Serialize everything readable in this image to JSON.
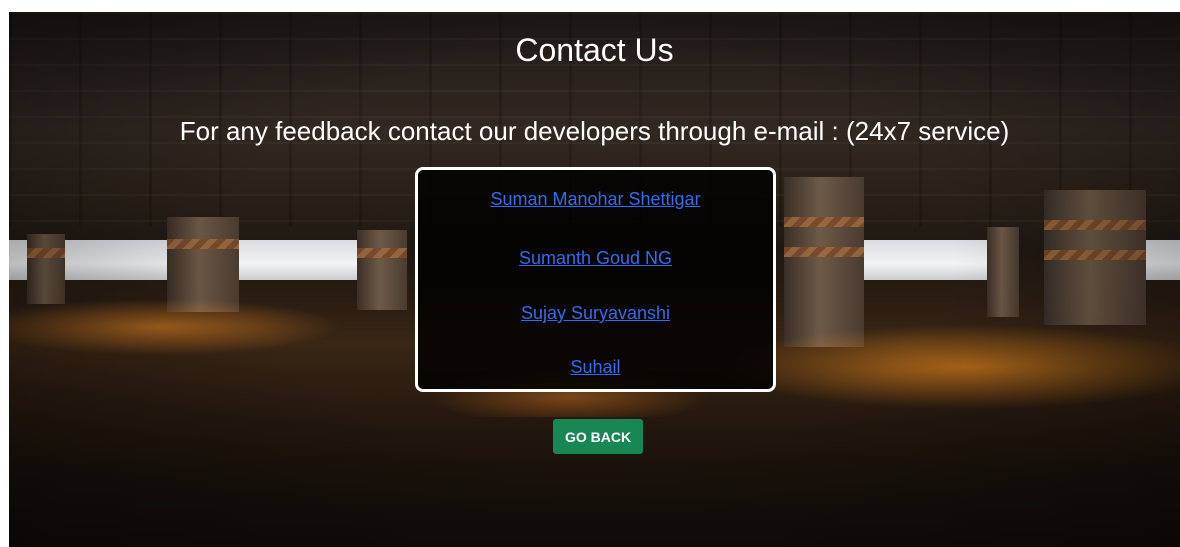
{
  "page": {
    "title": "Contact Us",
    "subtitle": "For any feedback contact our developers through e-mail : (24x7 service)"
  },
  "contacts": [
    {
      "name": "Suman Manohar Shettigar"
    },
    {
      "name": "Sumanth Goud NG"
    },
    {
      "name": "Sujay Suryavanshi"
    },
    {
      "name": "Suhail"
    }
  ],
  "actions": {
    "go_back_label": "GO BACK"
  },
  "colors": {
    "link": "#2f6cf0",
    "button": "#198754",
    "box_border": "#ffffff"
  }
}
